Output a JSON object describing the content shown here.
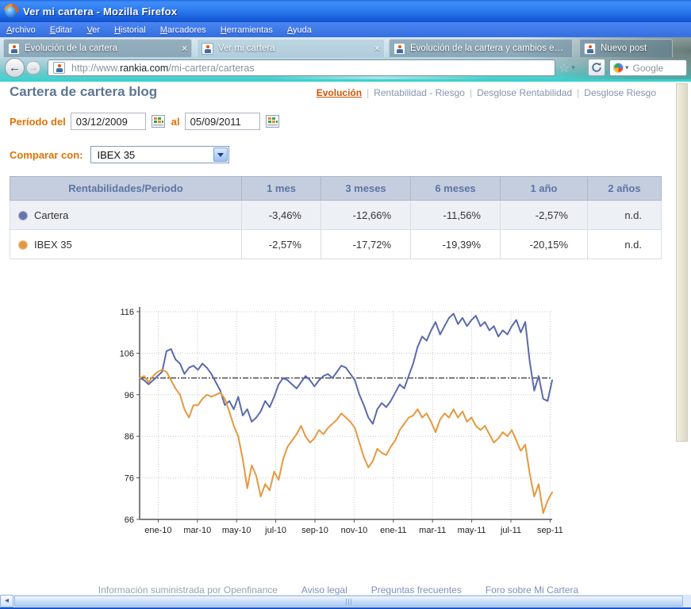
{
  "window": {
    "title": "Ver mi cartera - Mozilla Firefox"
  },
  "menubar": {
    "items": [
      "Archivo",
      "Editar",
      "Ver",
      "Historial",
      "Marcadores",
      "Herramientas",
      "Ayuda"
    ]
  },
  "tabs": [
    {
      "label": "Evolución de la cartera"
    },
    {
      "label": "Ver mi cartera"
    },
    {
      "label": "Evolución de la cartera y cambios en la ..."
    },
    {
      "label": "Nuevo post"
    }
  ],
  "navbar": {
    "url_prefix": "http://www.",
    "url_domain": "rankia.com",
    "url_path": "/mi-cartera/carteras",
    "search_label": "Google"
  },
  "page": {
    "title": "Cartera de cartera blog",
    "nav_links": [
      {
        "label": "Evolución"
      },
      {
        "label": "Rentabilidad - Riesgo"
      },
      {
        "label": "Desglose Rentabilidad"
      },
      {
        "label": "Desglose Riesgo"
      }
    ],
    "period": {
      "label": "Período del",
      "from": "03/12/2009",
      "to_label": "al",
      "to": "05/09/2011"
    },
    "compare": {
      "label": "Comparar con:",
      "selected": "IBEX 35"
    },
    "table": {
      "headers": [
        "Rentabilidades/Periodo",
        "1 mes",
        "3 meses",
        "6 meses",
        "1 año",
        "2 años"
      ],
      "rows": [
        {
          "name": "Cartera",
          "dot_color": "#6673ad",
          "values": [
            "-3,46%",
            "-12,66%",
            "-11,56%",
            "-2,57%",
            "n.d."
          ]
        },
        {
          "name": "IBEX 35",
          "dot_color": "#e39940",
          "values": [
            "-2,57%",
            "-17,72%",
            "-19,39%",
            "-20,15%",
            "n.d."
          ]
        }
      ]
    },
    "footer": {
      "info": "Información suministrada por Openfinance",
      "links": [
        "Aviso legal",
        "Preguntas frecuentes",
        "Foro sobre Mi Cartera"
      ]
    }
  },
  "chart_data": {
    "type": "line",
    "title": "",
    "xlabel": "",
    "ylabel": "",
    "ylim": [
      66,
      116
    ],
    "yticks": [
      66,
      76,
      86,
      96,
      106,
      116
    ],
    "grid": "dotted",
    "legend": "none",
    "reference_line": 100,
    "xtick_labels": [
      "ene-10",
      "mar-10",
      "may-10",
      "jul-10",
      "sep-10",
      "nov-10",
      "ene-11",
      "mar-11",
      "may-11",
      "jul-11",
      "sep-11"
    ],
    "xtick_fractions": [
      0.045,
      0.14,
      0.235,
      0.33,
      0.425,
      0.52,
      0.615,
      0.71,
      0.805,
      0.9,
      0.995
    ],
    "x_range": [
      "03/12/2009",
      "05/09/2011"
    ],
    "series": [
      {
        "name": "Cartera",
        "color": "#5a6bac",
        "values": [
          100,
          99.5,
          98.5,
          99.5,
          100.5,
          101.5,
          106.5,
          107,
          104.5,
          103.5,
          101,
          102.5,
          103,
          102,
          103.5,
          102.5,
          101,
          99,
          97,
          93.5,
          94.5,
          92.5,
          95.5,
          91,
          92.5,
          89.5,
          90.5,
          92,
          94.5,
          93,
          95.5,
          98.5,
          100,
          99.5,
          98.5,
          97.5,
          99,
          100.5,
          99.5,
          98,
          99.5,
          100.5,
          101,
          100,
          101.5,
          103,
          102.5,
          101,
          99.5,
          96,
          93.5,
          90.5,
          89,
          92.5,
          94,
          93,
          94.5,
          96.5,
          98.5,
          97.5,
          100.5,
          103.5,
          107.5,
          110,
          109,
          111.5,
          113.5,
          110.5,
          112.5,
          114.5,
          115.5,
          113,
          114.5,
          112.5,
          114,
          115,
          112.5,
          113.5,
          111.5,
          112.5,
          110,
          111.5,
          110.5,
          112.5,
          114,
          111,
          113.5,
          104,
          97,
          100.5,
          95,
          94.5,
          99.5
        ]
      },
      {
        "name": "IBEX 35",
        "color": "#e5993f",
        "values": [
          100,
          100.5,
          99,
          100.5,
          101.5,
          102,
          101.5,
          99.5,
          97.5,
          96,
          92.5,
          90.5,
          93.5,
          93.5,
          95,
          96,
          95.5,
          96,
          96.5,
          95,
          92,
          88.5,
          86,
          80.5,
          73.5,
          79,
          76.5,
          71.5,
          74.5,
          73,
          77.5,
          75.5,
          80.5,
          83.5,
          85,
          86.5,
          88.5,
          86,
          84.5,
          85.5,
          87.5,
          86.5,
          88,
          89,
          90,
          91.5,
          90.5,
          89.5,
          88,
          84.5,
          81,
          78.5,
          80,
          83,
          82,
          81.5,
          83.5,
          85,
          87.5,
          89,
          90.5,
          91,
          92.5,
          90.5,
          91.5,
          89.5,
          87,
          90,
          91.5,
          90.5,
          92.5,
          90.5,
          92,
          89.5,
          90.5,
          88.5,
          87.5,
          88.5,
          86.5,
          84.5,
          85.5,
          87,
          86,
          87.5,
          85,
          82.5,
          84,
          77,
          71.5,
          74.5,
          67.5,
          70.5,
          72.5
        ]
      }
    ]
  }
}
